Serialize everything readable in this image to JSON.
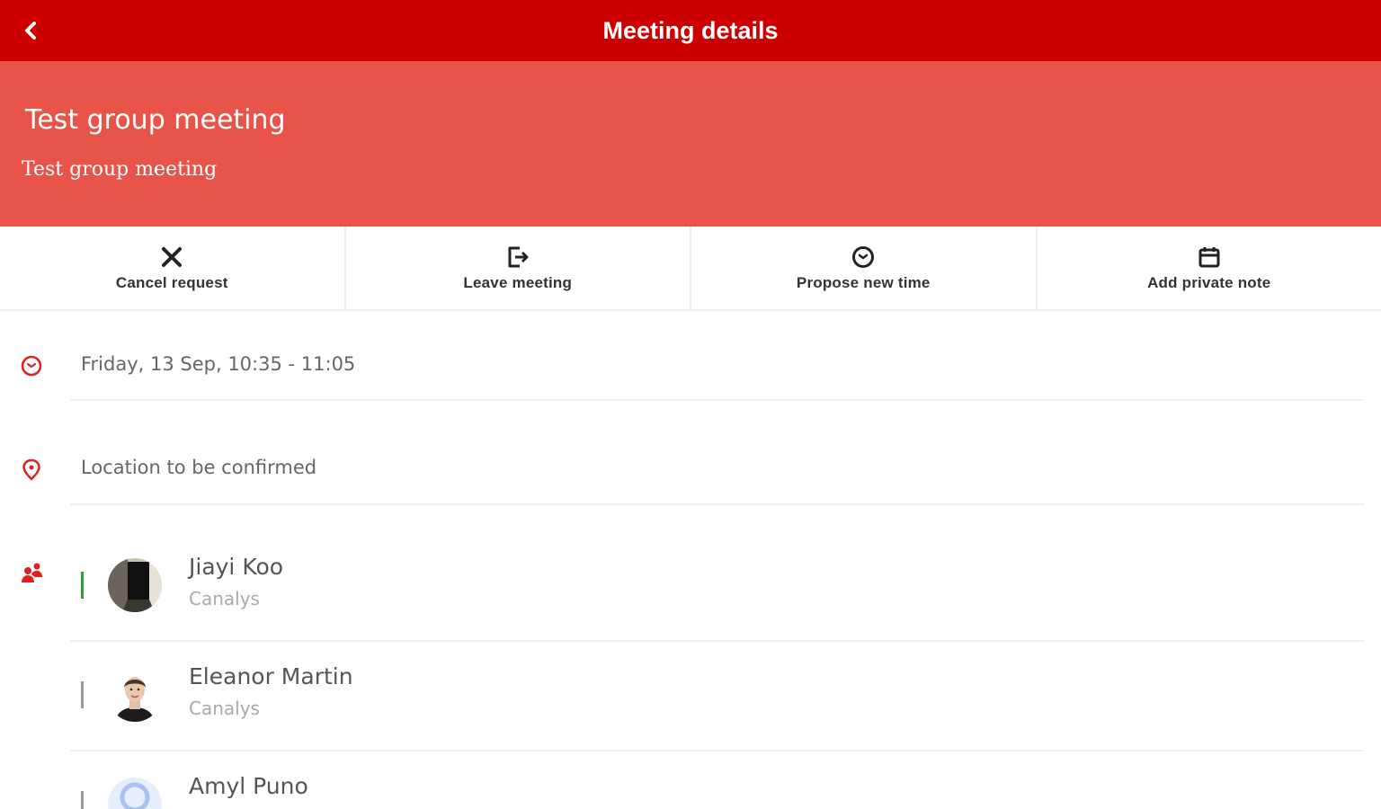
{
  "header": {
    "title": "Meeting details",
    "back_icon": "chevron-left-icon",
    "bar_color": "#cc0000"
  },
  "meeting": {
    "title": "Test group meeting",
    "subtitle": "Test group meeting",
    "hero_color": "#e8534a"
  },
  "actions": [
    {
      "label": "Cancel request",
      "icon": "close-icon"
    },
    {
      "label": "Leave meeting",
      "icon": "exit-icon"
    },
    {
      "label": "Propose new time",
      "icon": "clock-icon"
    },
    {
      "label": "Add private note",
      "icon": "calendar-icon"
    }
  ],
  "details": {
    "datetime": "Friday, 13 Sep, 10:35 - 11:05",
    "location": "Location to be confirmed"
  },
  "attendees": [
    {
      "name": "Jiayi Koo",
      "org": "Canalys",
      "status_color": "#2e9d3a",
      "avatar": "photo"
    },
    {
      "name": "Eleanor Martin",
      "org": "Canalys",
      "status_color": "#999999",
      "avatar": "photo"
    },
    {
      "name": "Amyl Puno",
      "org": "",
      "status_color": "#999999",
      "avatar": "placeholder"
    }
  ],
  "accent_color": "#e02020"
}
